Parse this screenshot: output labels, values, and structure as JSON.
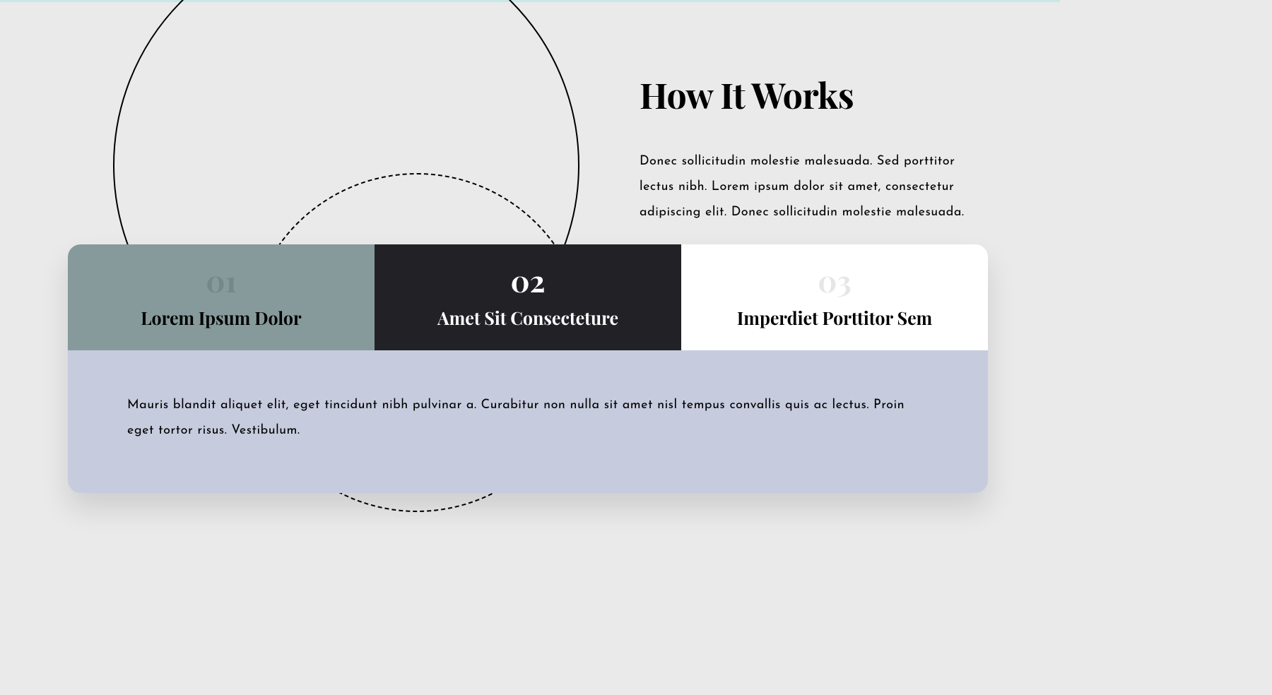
{
  "intro": {
    "heading": "How It Works",
    "text": "Donec sollicitudin molestie malesuada. Sed porttitor lectus nibh. Lorem ipsum dolor sit amet, consectetur adipiscing elit. Donec sollicitudin molestie malesuada."
  },
  "tabs": [
    {
      "number": "01",
      "title": "Lorem Ipsum Dolor"
    },
    {
      "number": "02",
      "title": "Amet Sit Consecteture"
    },
    {
      "number": "03",
      "title": "Imperdiet Porttitor Sem"
    }
  ],
  "content": "Mauris blandit aliquet elit, eget tincidunt nibh pulvinar a. Curabitur non nulla sit amet nisl tempus convallis quis ac lectus. Proin eget tortor risus. Vestibulum."
}
